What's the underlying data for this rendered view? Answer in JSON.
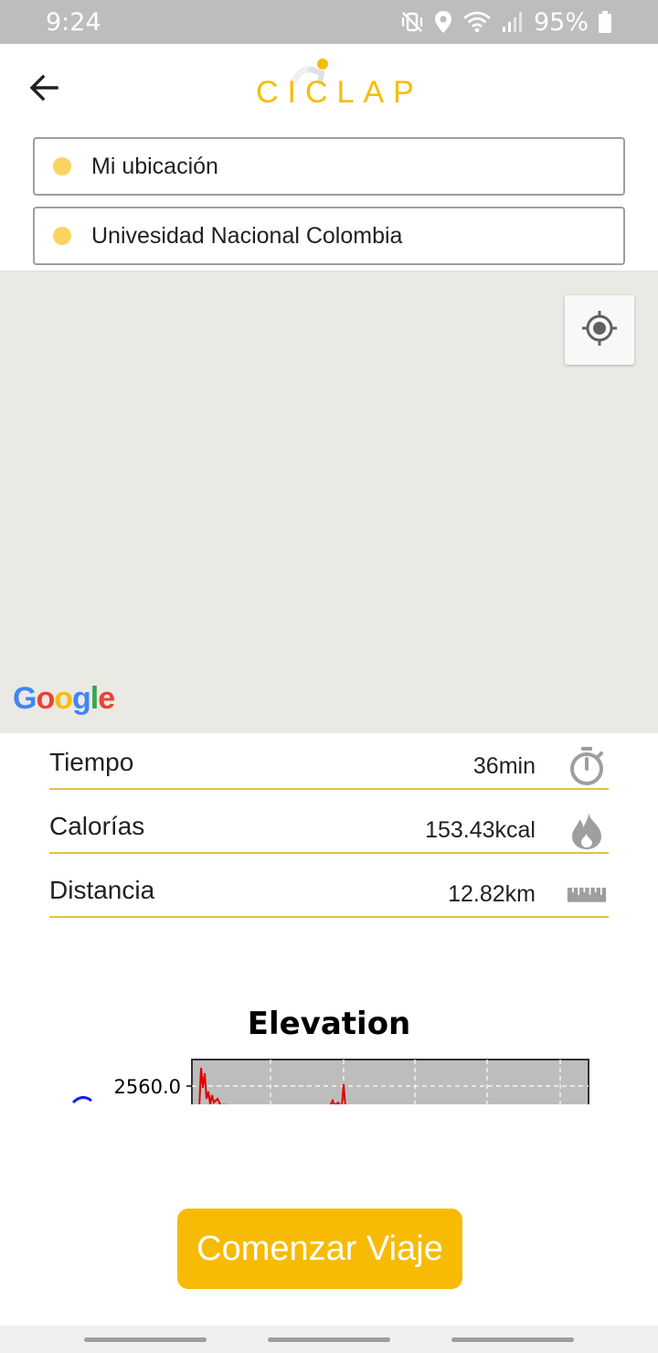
{
  "status_bar": {
    "time": "9:24",
    "battery": "95%",
    "icons": [
      "mute-vibrate-icon",
      "location-icon",
      "wifi-icon",
      "signal-icon",
      "battery-icon"
    ]
  },
  "app_bar": {
    "back_icon": "arrow-left-icon",
    "logo_text": "CICLAP",
    "brand_color": "#f5bd00"
  },
  "route": {
    "origin": "Mi ubicación",
    "destination": "Univesidad Nacional Colombia",
    "dot_color": "#fbd361"
  },
  "map": {
    "attribution": "Google",
    "locate_icon": "my-location-icon"
  },
  "stats": [
    {
      "label": "Tiempo",
      "value": "36min",
      "icon": "stopwatch-icon"
    },
    {
      "label": "Calorías",
      "value": "153.43kcal",
      "icon": "flame-icon"
    },
    {
      "label": "Distancia",
      "value": "12.82km",
      "icon": "ruler-icon"
    }
  ],
  "chart_data": {
    "type": "line",
    "title": "Elevation",
    "yticks": [
      "2560.0"
    ],
    "grid": true,
    "series": [
      {
        "color": "#e00000"
      }
    ]
  },
  "start_button": {
    "label": "Comenzar Viaje",
    "color": "#f7bb05"
  }
}
